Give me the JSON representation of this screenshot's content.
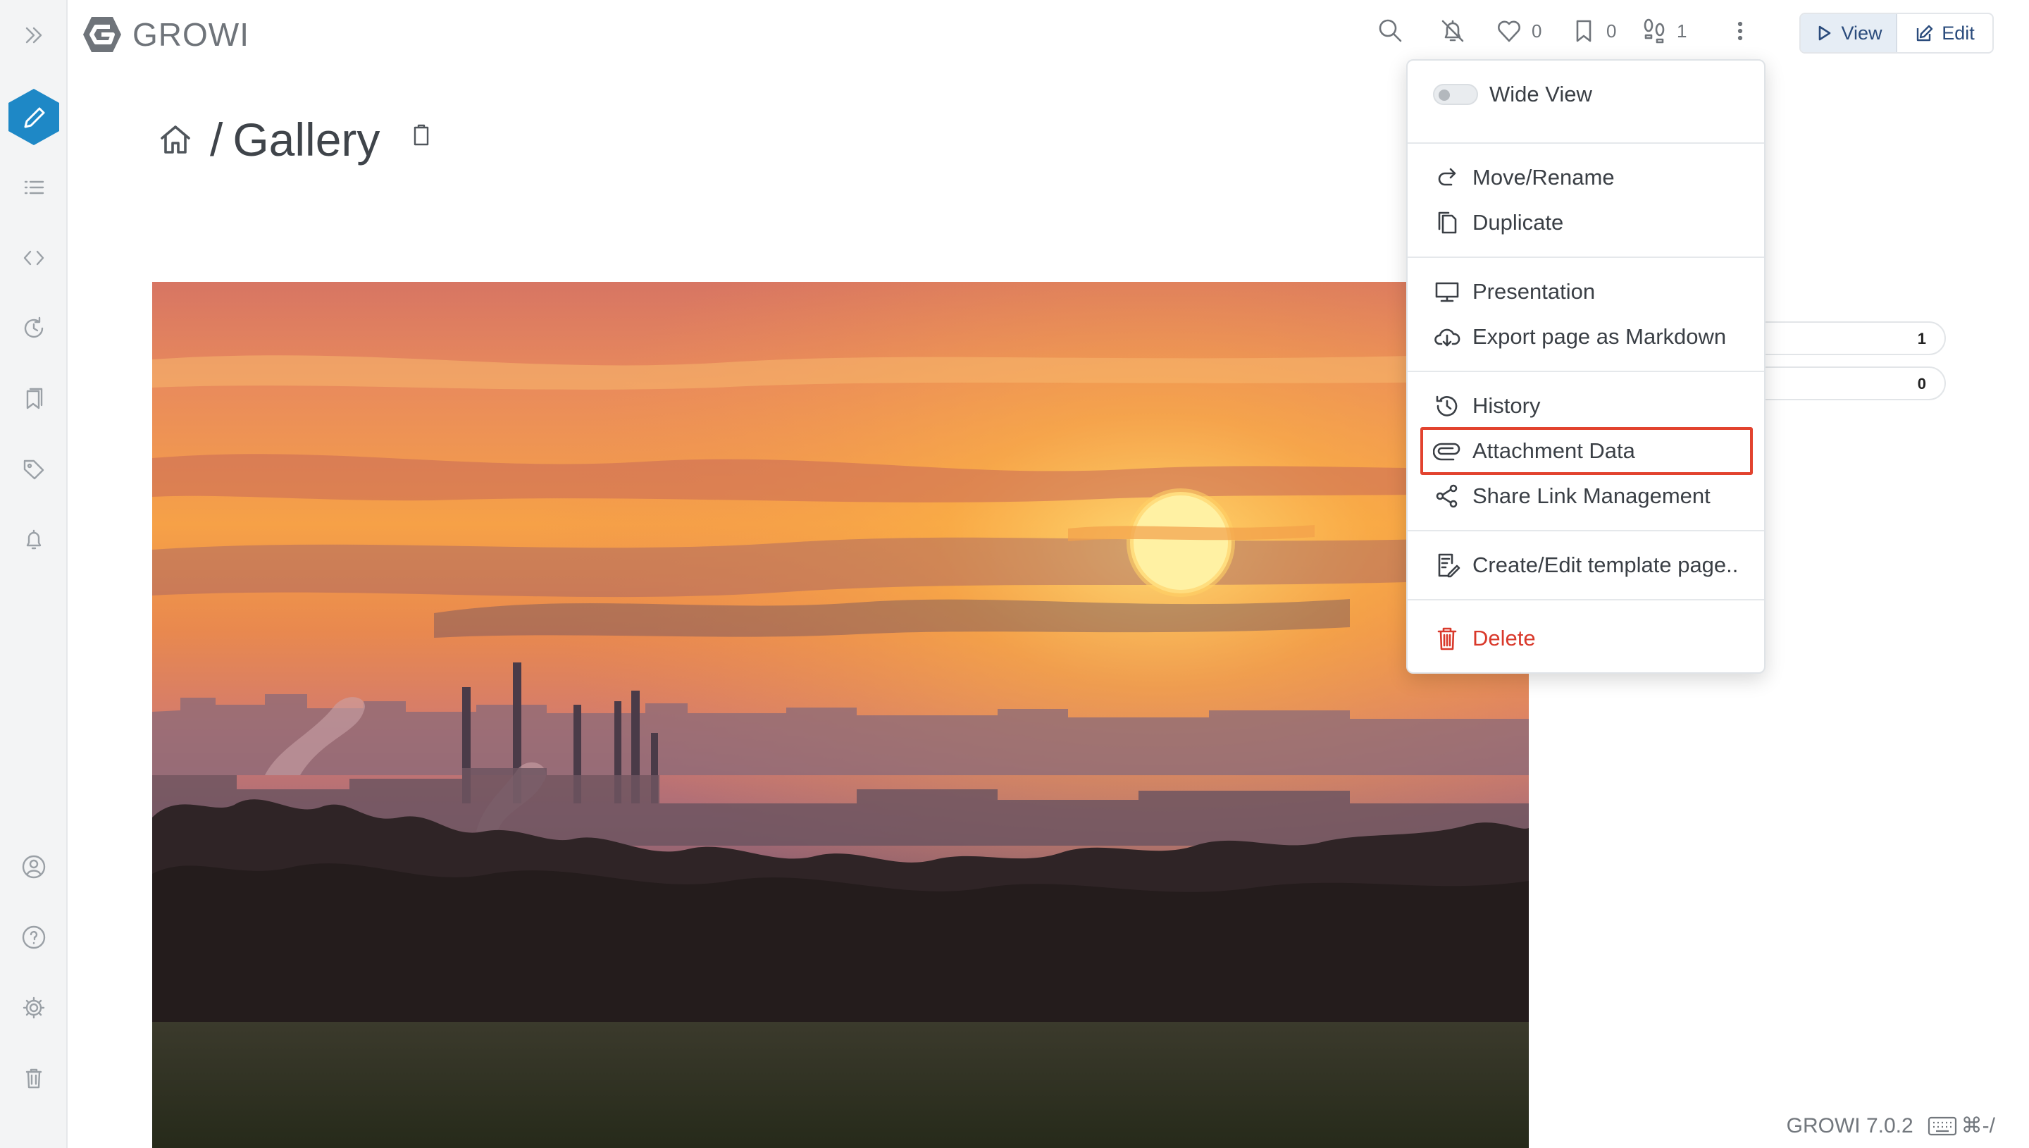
{
  "app": {
    "brand": "GROWI",
    "accent_color": "#1e88c6"
  },
  "sidebar": {
    "items": [
      {
        "icon": "double-chevron-right-icon",
        "label": ""
      },
      {
        "icon": "pencil-create-icon",
        "label": ""
      },
      {
        "icon": "list-icon",
        "label": ""
      },
      {
        "icon": "code-brackets-icon",
        "label": ""
      },
      {
        "icon": "recent-clock-icon",
        "label": ""
      },
      {
        "icon": "bookmarks-icon",
        "label": ""
      },
      {
        "icon": "tag-icon",
        "label": ""
      },
      {
        "icon": "bell-icon",
        "label": ""
      },
      {
        "icon": "user-circle-icon",
        "label": ""
      },
      {
        "icon": "help-icon",
        "label": ""
      },
      {
        "icon": "gear-icon",
        "label": ""
      },
      {
        "icon": "trash-icon",
        "label": ""
      }
    ]
  },
  "toolbar": {
    "likes_count": "0",
    "bookmarks_count": "0",
    "seen_count": "1",
    "view_label": "View",
    "edit_label": "Edit"
  },
  "page": {
    "path_separator": "/",
    "title": "Gallery"
  },
  "side_counts": [
    "1",
    "0"
  ],
  "menu": {
    "wide_view": "Wide View",
    "move_rename": "Move/Rename",
    "duplicate": "Duplicate",
    "presentation": "Presentation",
    "export_markdown": "Export page as Markdown",
    "history": "History",
    "attachment_data": "Attachment Data",
    "share_link": "Share Link Management",
    "template": "Create/Edit template page..",
    "delete": "Delete",
    "delete_color": "#d9392b",
    "highlight_color": "#e2432f"
  },
  "footer": {
    "version": "GROWI 7.0.2",
    "shortcut": "⌘-/"
  }
}
